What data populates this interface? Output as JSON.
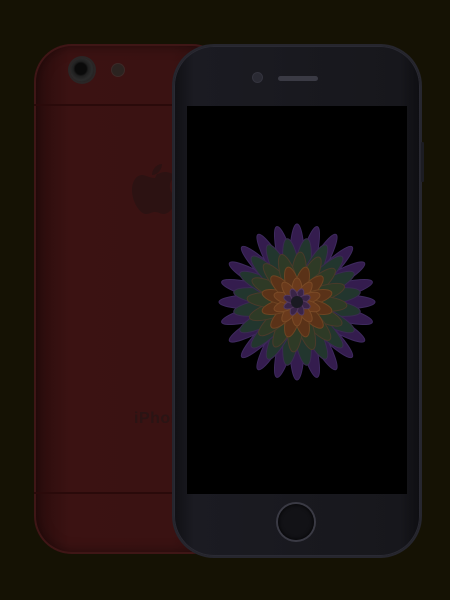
{
  "scene": {
    "description_word": "",
    "colors": {
      "background": "#151204",
      "back_phone": "#3a1212",
      "front_phone": "#17171c",
      "screen": "#000000"
    }
  },
  "back_phone": {
    "wordmark": "iPhone",
    "icons": [
      "camera-icon",
      "flash-icon",
      "apple-logo-icon"
    ]
  },
  "front_phone": {
    "icons": [
      "front-camera-icon",
      "speaker-icon",
      "home-button-icon"
    ],
    "wallpaper": "flower-wallpaper"
  }
}
